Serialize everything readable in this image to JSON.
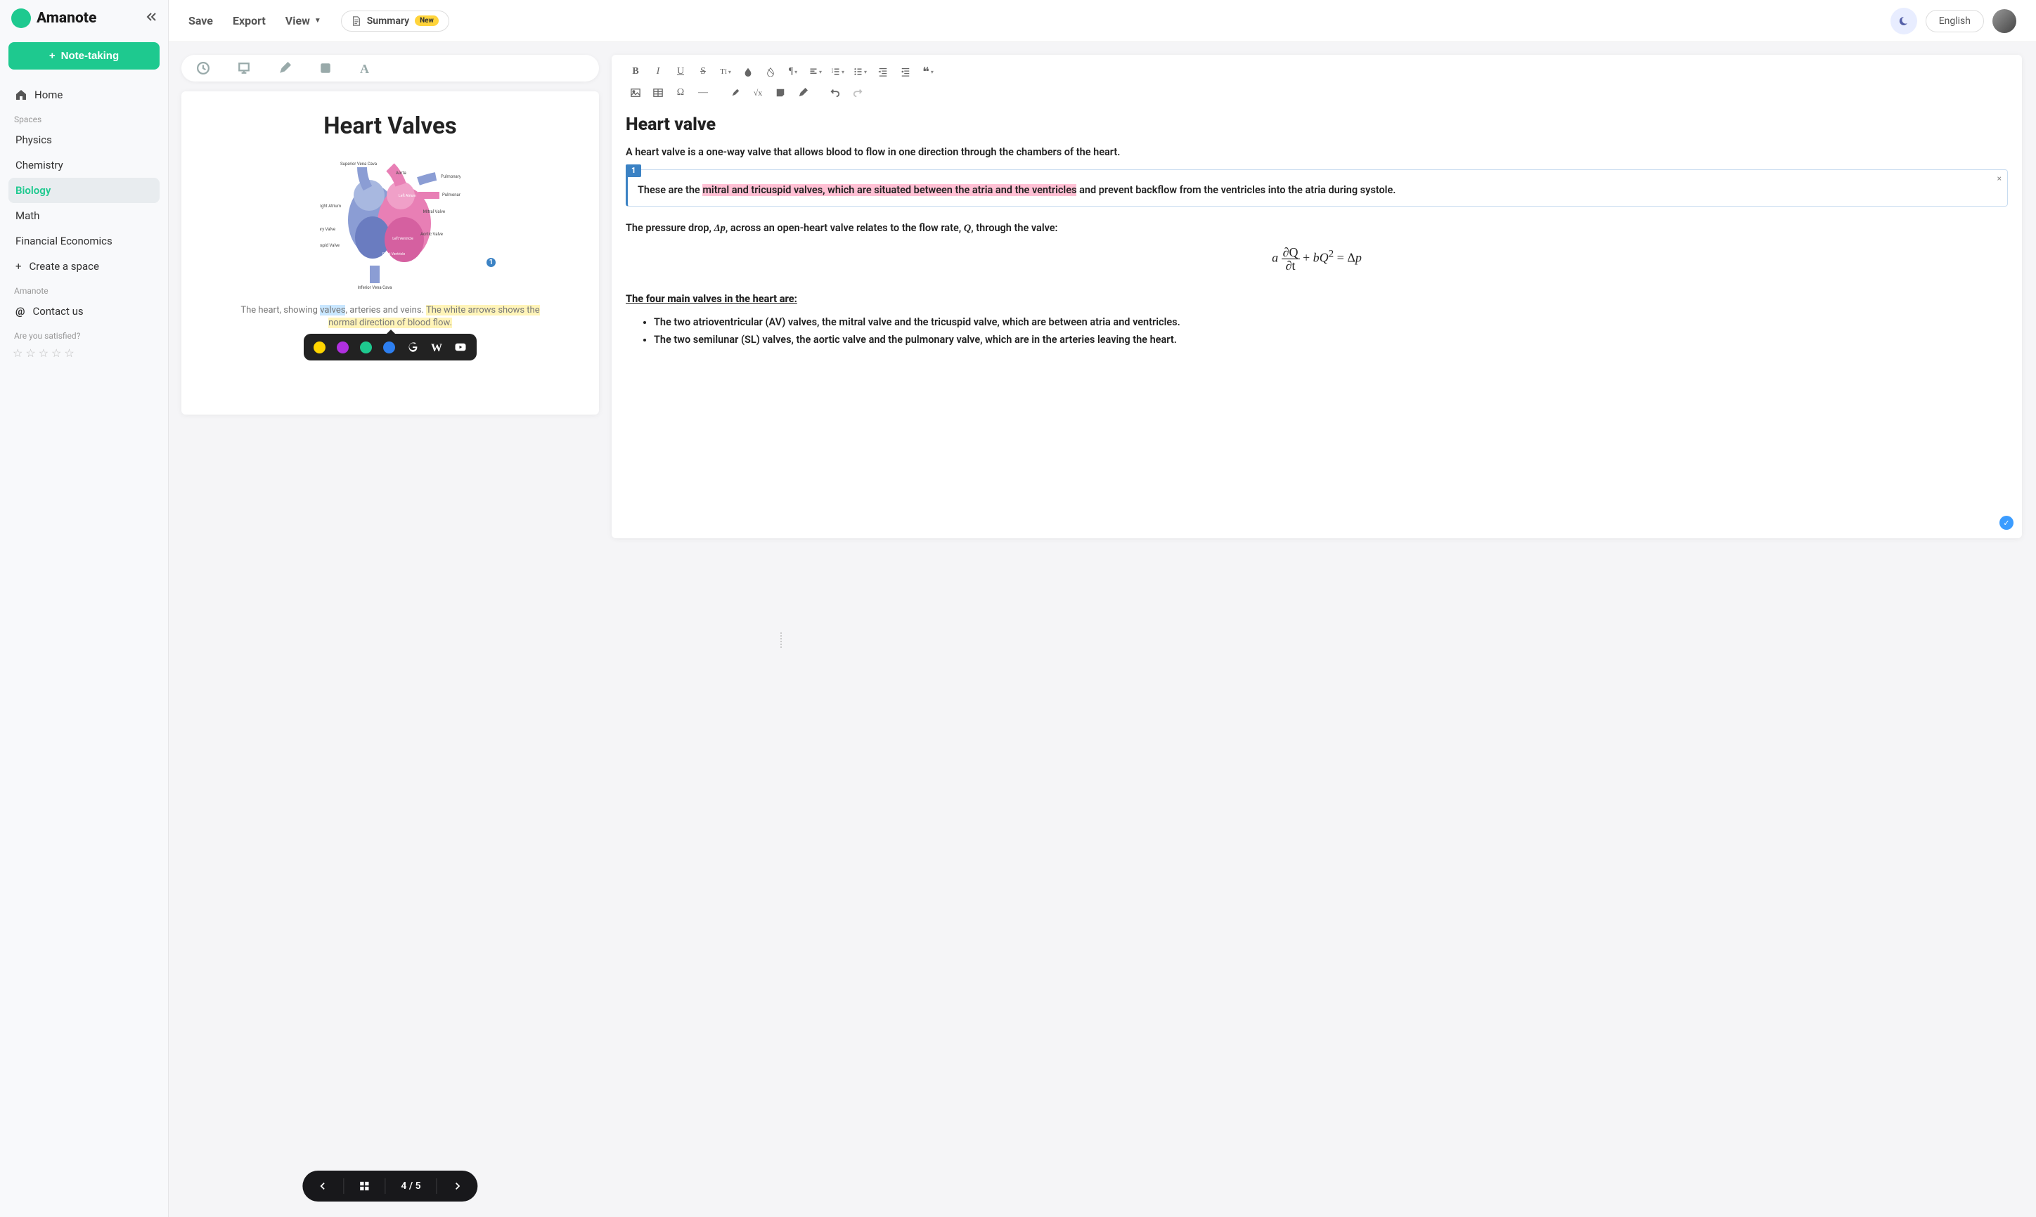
{
  "brand": "Amanote",
  "sidebar": {
    "main_button": "Note-taking",
    "home": "Home",
    "spaces_label": "Spaces",
    "spaces": [
      "Physics",
      "Chemistry",
      "Biology",
      "Math",
      "Financial Economics"
    ],
    "active_space_index": 2,
    "create_space": "Create a space",
    "amanote_label": "Amanote",
    "contact": "Contact us",
    "satisfied_label": "Are you satisfied?"
  },
  "header": {
    "save": "Save",
    "export": "Export",
    "view": "View",
    "summary": "Summary",
    "summary_badge": "New",
    "language": "English"
  },
  "document": {
    "title": "Heart Valves",
    "annotation_number": "1",
    "caption_pre": "The heart, showing ",
    "caption_hl1": "valves",
    "caption_mid": ", arteries and veins. ",
    "caption_hl2": "The white arrows shows the normal direction of blood flow.",
    "heart_labels": {
      "svc": "Superior Vena Cava",
      "aorta": "Aorta",
      "pa": "Pulmonary Artery",
      "pv": "Pulmonary Vein",
      "la": "Left Atrium",
      "mv": "Mitral Valve",
      "av": "Aortic Valve",
      "lv": "Left Ventricle",
      "ra": "Right Atrium",
      "pulv": "Pulmonary Valve",
      "tv": "Tricuspid Valve",
      "rv": "Right Ventricle",
      "ivc": "Inferior Vena Cava"
    },
    "page_indicator": "4 / 5"
  },
  "popup_colors": [
    "#ffd500",
    "#b030e0",
    "#1ec98f",
    "#2d7ff0"
  ],
  "editor": {
    "title": "Heart valve",
    "intro": "A heart valve is a one-way valve that allows blood to flow in one direction through the chambers of the heart.",
    "note_tag": "1",
    "note_pre": "These are the ",
    "note_hl": "mitral and tricuspid valves, which are situated between the atria and the ventricles",
    "note_post": " and prevent backflow from the ventricles into the atria during systole.",
    "pressure_pre": "The pressure drop, ",
    "pressure_dp": "Δp",
    "pressure_mid": ", across an open-heart valve relates to the flow rate, ",
    "pressure_q": "Q",
    "pressure_post": ", through the valve:",
    "formula": "a ∂Q/∂t + bQ² = Δp",
    "subheading": "The four main valves in the heart are:",
    "bullets": [
      "The two atrioventricular (AV) valves, the mitral valve and the tricuspid valve, which are between atria and ventricles.",
      "The two semilunar (SL) valves, the aortic valve and the pulmonary valve, which are in the arteries leaving the heart."
    ]
  }
}
